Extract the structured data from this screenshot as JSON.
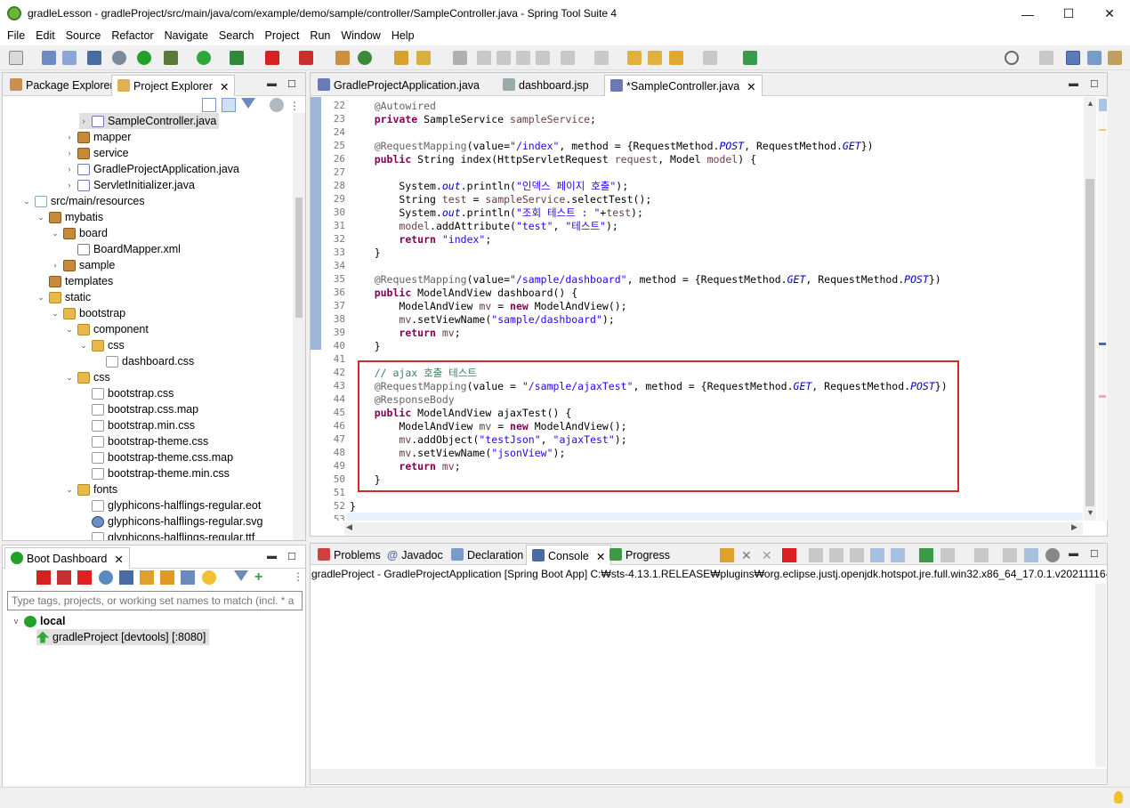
{
  "window": {
    "title": "gradleLesson - gradleProject/src/main/java/com/example/demo/sample/controller/SampleController.java - Spring Tool Suite 4",
    "minimize": "—",
    "maximize": "☐",
    "close": "✕"
  },
  "menu": [
    "File",
    "Edit",
    "Source",
    "Refactor",
    "Navigate",
    "Search",
    "Project",
    "Run",
    "Window",
    "Help"
  ],
  "explorer": {
    "tabs": [
      "Package Explorer",
      "Project Explorer"
    ],
    "tree": [
      {
        "label": "SampleController.java",
        "kind": "java",
        "depth": 5,
        "twisty": ">"
      },
      {
        "label": "mapper",
        "kind": "pkg",
        "depth": 4,
        "twisty": ">"
      },
      {
        "label": "service",
        "kind": "pkg",
        "depth": 4,
        "twisty": ">"
      },
      {
        "label": "GradleProjectApplication.java",
        "kind": "java",
        "depth": 4,
        "twisty": ">"
      },
      {
        "label": "ServletInitializer.java",
        "kind": "java",
        "depth": 4,
        "twisty": ">"
      },
      {
        "label": "src/main/resources",
        "kind": "src",
        "depth": 1,
        "twisty": "v"
      },
      {
        "label": "mybatis",
        "kind": "pkg",
        "depth": 2,
        "twisty": "v"
      },
      {
        "label": "board",
        "kind": "pkg",
        "depth": 3,
        "twisty": "v"
      },
      {
        "label": "BoardMapper.xml",
        "kind": "xml",
        "depth": 4,
        "twisty": ""
      },
      {
        "label": "sample",
        "kind": "pkg",
        "depth": 3,
        "twisty": ">"
      },
      {
        "label": "templates",
        "kind": "pkg",
        "depth": 2,
        "twisty": ""
      },
      {
        "label": "static",
        "kind": "folder",
        "depth": 2,
        "twisty": "v"
      },
      {
        "label": "bootstrap",
        "kind": "folder",
        "depth": 3,
        "twisty": "v"
      },
      {
        "label": "component",
        "kind": "folder",
        "depth": 4,
        "twisty": "v"
      },
      {
        "label": "css",
        "kind": "folder",
        "depth": 5,
        "twisty": "v"
      },
      {
        "label": "dashboard.css",
        "kind": "file",
        "depth": 6,
        "twisty": ""
      },
      {
        "label": "css",
        "kind": "folder",
        "depth": 4,
        "twisty": "v"
      },
      {
        "label": "bootstrap.css",
        "kind": "file",
        "depth": 5,
        "twisty": ""
      },
      {
        "label": "bootstrap.css.map",
        "kind": "file",
        "depth": 5,
        "twisty": ""
      },
      {
        "label": "bootstrap.min.css",
        "kind": "file",
        "depth": 5,
        "twisty": ""
      },
      {
        "label": "bootstrap-theme.css",
        "kind": "file",
        "depth": 5,
        "twisty": ""
      },
      {
        "label": "bootstrap-theme.css.map",
        "kind": "file",
        "depth": 5,
        "twisty": ""
      },
      {
        "label": "bootstrap-theme.min.css",
        "kind": "file",
        "depth": 5,
        "twisty": ""
      },
      {
        "label": "fonts",
        "kind": "folder",
        "depth": 4,
        "twisty": "v"
      },
      {
        "label": "glyphicons-halflings-regular.eot",
        "kind": "file",
        "depth": 5,
        "twisty": ""
      },
      {
        "label": "glyphicons-halflings-regular.svg",
        "kind": "globe",
        "depth": 5,
        "twisty": ""
      },
      {
        "label": "glyphicons-halflings-regular.ttf",
        "kind": "file",
        "depth": 5,
        "twisty": ""
      }
    ]
  },
  "boot_dashboard": {
    "tab": "Boot Dashboard",
    "filter_placeholder": "Type tags, projects, or working set names to match (incl. * a",
    "group": "local",
    "app": "gradleProject [devtools] [:8080]"
  },
  "editor": {
    "tabs": [
      "GradleProjectApplication.java",
      "dashboard.jsp",
      "*SampleController.java"
    ],
    "lines": [
      {
        "n": "22",
        "html": "    <span class=\"a\">@Autowired</span>"
      },
      {
        "n": "23",
        "html": "    <span class=\"k\">private</span> SampleService <span class=\"v\">sampleService</span>;"
      },
      {
        "n": "24",
        "html": ""
      },
      {
        "n": "25",
        "html": "    <span class=\"a\">@RequestMapping</span>(value=<span class=\"s\">\"/index\"</span>, method = {RequestMethod.<span class=\"f\">POST</span>, RequestMethod.<span class=\"f\">GET</span>})"
      },
      {
        "n": "26",
        "html": "    <span class=\"k\">public</span> String index(HttpServletRequest <span class=\"v\">request</span>, Model <span class=\"v\">model</span>) {"
      },
      {
        "n": "27",
        "html": ""
      },
      {
        "n": "28",
        "html": "        System.<span class=\"f\">out</span>.println(<span class=\"s\">\"인덱스 페이지 호출\"</span>);"
      },
      {
        "n": "29",
        "html": "        String <span class=\"v\">test</span> = <span class=\"v\">sampleService</span>.selectTest();"
      },
      {
        "n": "30",
        "html": "        System.<span class=\"f\">out</span>.println(<span class=\"s\">\"조회 테스트 : \"</span>+<span class=\"v\">test</span>);"
      },
      {
        "n": "31",
        "html": "        <span class=\"v\">model</span>.addAttribute(<span class=\"s\">\"test\"</span>, <span class=\"s\">\"테스트\"</span>);"
      },
      {
        "n": "32",
        "html": "        <span class=\"k\">return</span> <span class=\"s\">\"index\"</span>;"
      },
      {
        "n": "33",
        "html": "    }"
      },
      {
        "n": "34",
        "html": ""
      },
      {
        "n": "35",
        "html": "    <span class=\"a\">@RequestMapping</span>(value=<span class=\"s\">\"/sample/dashboard\"</span>, method = {RequestMethod.<span class=\"f\">GET</span>, RequestMethod.<span class=\"f\">POST</span>})"
      },
      {
        "n": "36",
        "html": "    <span class=\"k\">public</span> ModelAndView dashboard() {"
      },
      {
        "n": "37",
        "html": "        ModelAndView <span class=\"v\">mv</span> = <span class=\"k\">new</span> ModelAndView();"
      },
      {
        "n": "38",
        "html": "        <span class=\"v\">mv</span>.setViewName(<span class=\"s\">\"sample/dashboard\"</span>);"
      },
      {
        "n": "39",
        "html": "        <span class=\"k\">return</span> <span class=\"v\">mv</span>;"
      },
      {
        "n": "40",
        "html": "    }"
      },
      {
        "n": "41",
        "html": ""
      },
      {
        "n": "42",
        "html": "    <span class=\"c\">// ajax 호출 테스트</span>"
      },
      {
        "n": "43",
        "html": "    <span class=\"a\">@RequestMapping</span>(value = <span class=\"s\">\"/sample/ajaxTest\"</span>, method = {RequestMethod.<span class=\"f\">GET</span>, RequestMethod.<span class=\"f\">POST</span>})"
      },
      {
        "n": "44",
        "html": "    <span class=\"a\">@ResponseBody</span>"
      },
      {
        "n": "45",
        "html": "    <span class=\"k\">public</span> ModelAndView ajaxTest() {"
      },
      {
        "n": "46",
        "html": "        ModelAndView <span class=\"v\">mv</span> = <span class=\"k\">new</span> ModelAndView();"
      },
      {
        "n": "47",
        "html": "        <span class=\"v\">mv</span>.addObject(<span class=\"s\">\"testJson\"</span>, <span class=\"s\">\"ajaxTest\"</span>);"
      },
      {
        "n": "48",
        "html": "        <span class=\"v\">mv</span>.setViewName(<span class=\"s\">\"jsonView\"</span>);"
      },
      {
        "n": "49",
        "html": "        <span class=\"k\">return</span> <span class=\"v\">mv</span>;"
      },
      {
        "n": "50",
        "html": "    }"
      },
      {
        "n": "51",
        "html": ""
      },
      {
        "n": "52",
        "html": "}"
      },
      {
        "n": "53",
        "html": ""
      }
    ]
  },
  "bottom": {
    "tabs": [
      "Problems",
      "Javadoc",
      "Declaration",
      "Console",
      "Progress"
    ],
    "console_header": "gradleProject - GradleProjectApplication [Spring Boot App] C:₩sts-4.13.1.RELEASE₩plugins₩org.eclipse.justj.openjdk.hotspot.jre.full.win32.x86_64_17.0.1.v20211116-"
  },
  "colors": {
    "accent": "#6db33f",
    "highlight_box": "#d62828",
    "keyword": "#7f0055",
    "string": "#2a00ff"
  }
}
